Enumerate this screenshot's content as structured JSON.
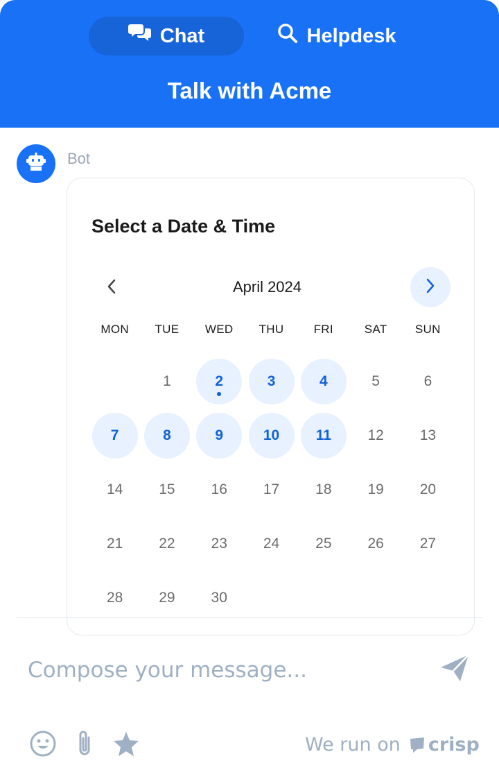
{
  "header": {
    "tabs": [
      {
        "label": "Chat",
        "icon": "chat-bubbles-icon",
        "active": true
      },
      {
        "label": "Helpdesk",
        "icon": "search-icon",
        "active": false
      }
    ],
    "title": "Talk with Acme"
  },
  "message": {
    "sender": "Bot",
    "avatar_icon": "robot-icon"
  },
  "scheduler": {
    "title": "Select a Date & Time",
    "month": "April 2024",
    "weekdays": [
      "MON",
      "TUE",
      "WED",
      "THU",
      "FRI",
      "SAT",
      "SUN"
    ],
    "weeks": [
      [
        "",
        "1",
        "2",
        "3",
        "4",
        "5",
        "6"
      ],
      [
        "7",
        "8",
        "9",
        "10",
        "11",
        "12",
        "13"
      ],
      [
        "14",
        "15",
        "16",
        "17",
        "18",
        "19",
        "20"
      ],
      [
        "21",
        "22",
        "23",
        "24",
        "25",
        "26",
        "27"
      ],
      [
        "28",
        "29",
        "30",
        "",
        "",
        "",
        ""
      ]
    ],
    "available_days": [
      "2",
      "3",
      "4",
      "7",
      "8",
      "9",
      "10",
      "11"
    ],
    "today": "2"
  },
  "composer": {
    "placeholder": "Compose your message...",
    "value": ""
  },
  "footer": {
    "powered_text": "We run on",
    "brand": "crisp"
  },
  "colors": {
    "primary": "#1972f5",
    "available_bg": "#e8f1ff",
    "available_text": "#0f62d8",
    "muted": "#9fb0c4"
  }
}
